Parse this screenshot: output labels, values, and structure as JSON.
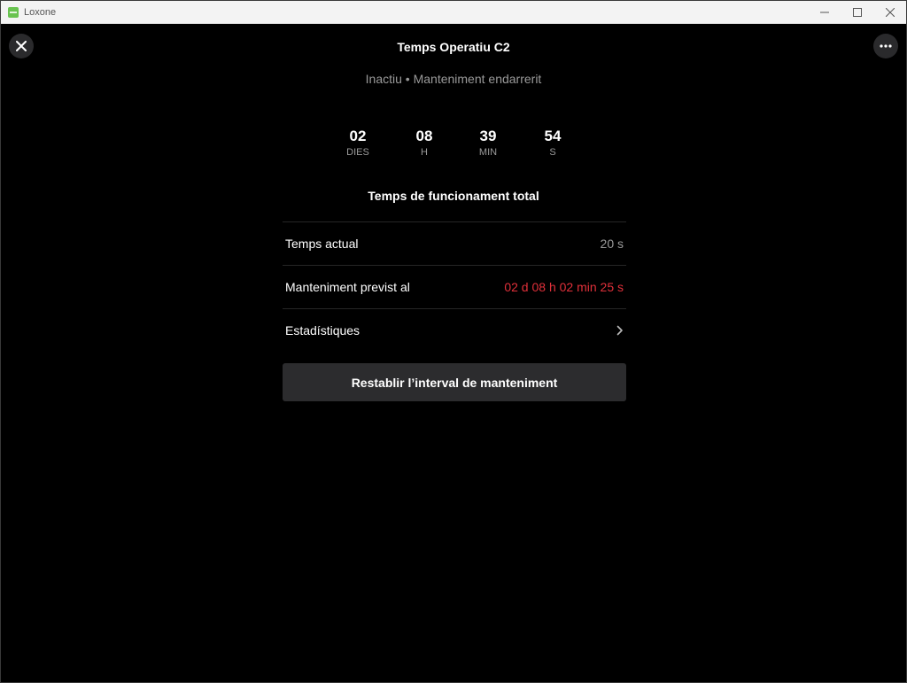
{
  "window": {
    "app_title": "Loxone",
    "app_icon": "loxone-logo-icon",
    "accent_color": "#69c350"
  },
  "header": {
    "title": "Temps Operatiu C2",
    "close_icon": "close-icon",
    "more_icon": "more-dots-icon"
  },
  "status": {
    "text": "Inactiu • Manteniment endarrerit"
  },
  "counters": [
    {
      "value": "02",
      "unit": "DIES"
    },
    {
      "value": "08",
      "unit": "H"
    },
    {
      "value": "39",
      "unit": "MIN"
    },
    {
      "value": "54",
      "unit": "S"
    }
  ],
  "total_label": "Temps de funcionament total",
  "rows": [
    {
      "label": "Temps actual",
      "value": "20 s"
    },
    {
      "label": "Manteniment previst al",
      "value": "02 d 08 h 02 min 25 s",
      "value_color": "#e0303a"
    },
    {
      "label": "Estadístiques",
      "icon": "chevron-right-icon"
    }
  ],
  "reset_button": {
    "label": "Restablir l’interval de manteniment"
  }
}
